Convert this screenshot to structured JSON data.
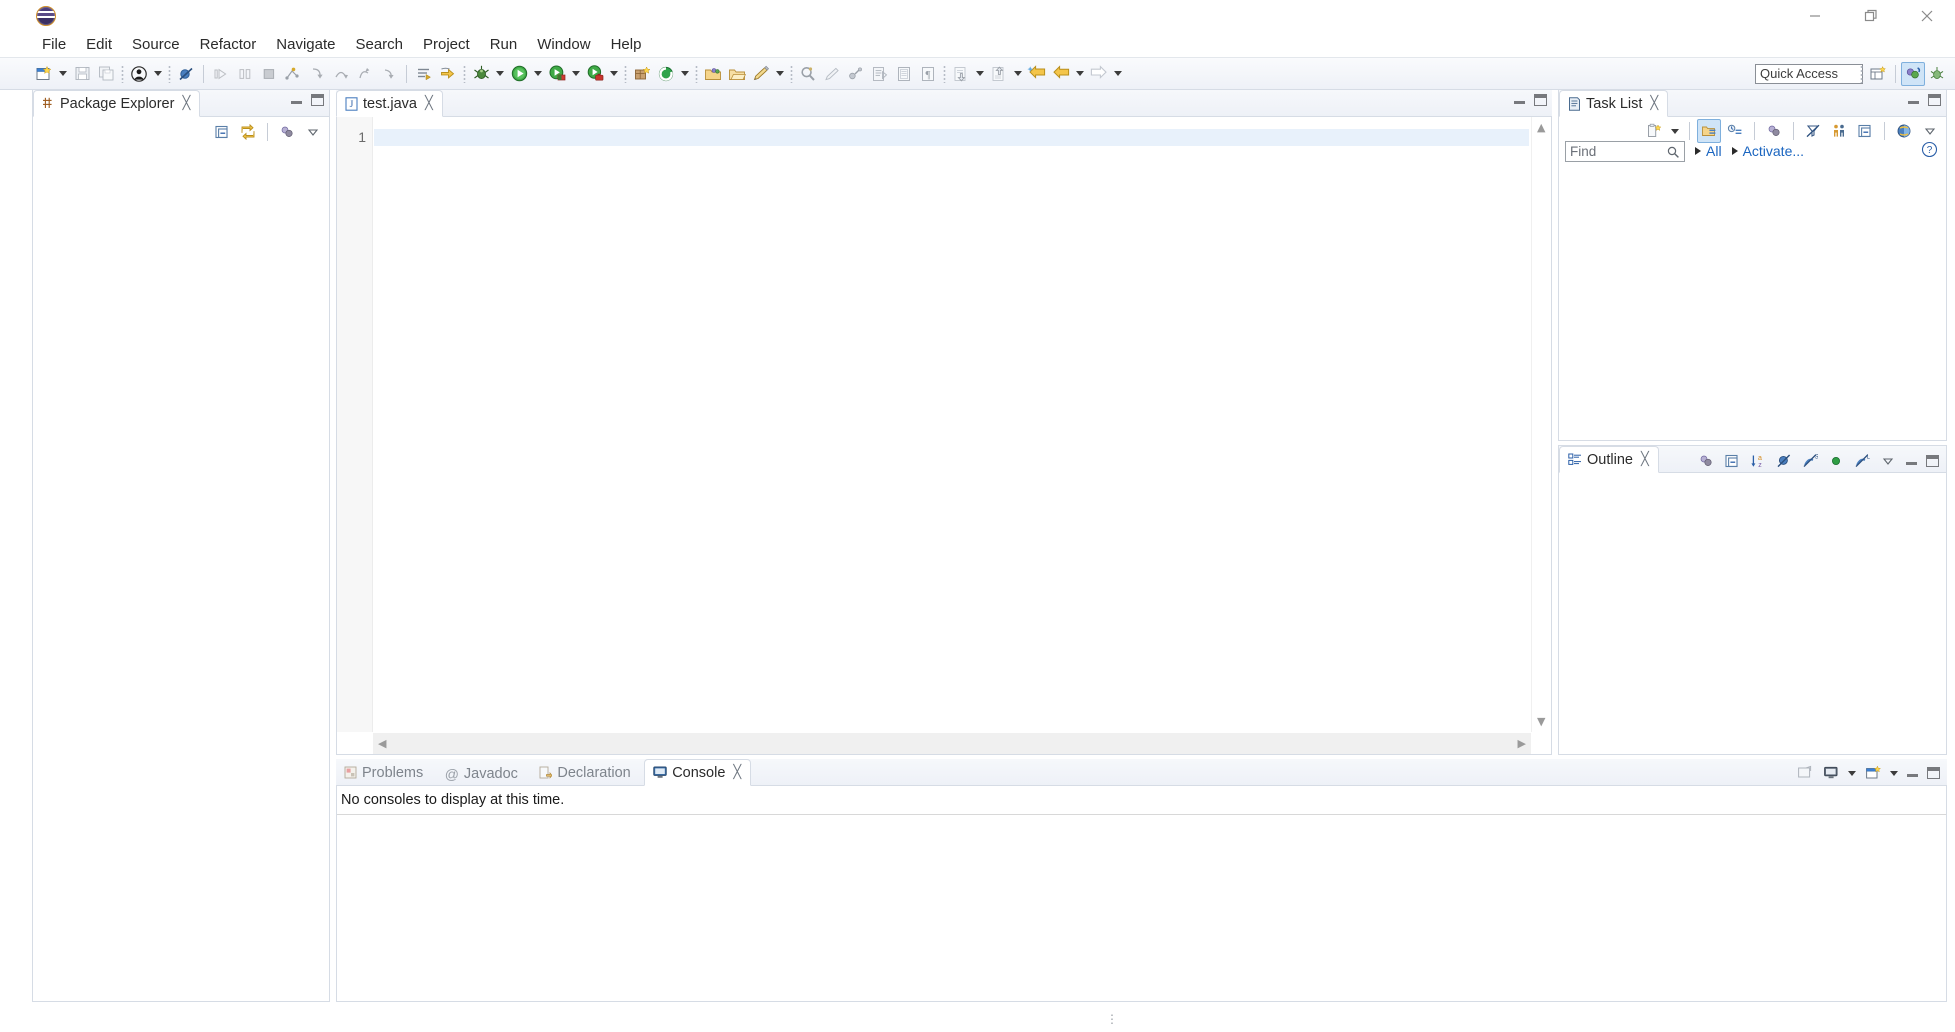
{
  "window": {
    "title": "",
    "logo_icon": "eclipse-logo-icon",
    "controls": [
      {
        "name": "minimize-button",
        "glyph": "—"
      },
      {
        "name": "restore-button",
        "glyph": "❐"
      },
      {
        "name": "close-button",
        "glyph": "✕"
      }
    ]
  },
  "menubar": {
    "items": [
      {
        "label": "File"
      },
      {
        "label": "Edit"
      },
      {
        "label": "Source"
      },
      {
        "label": "Refactor"
      },
      {
        "label": "Navigate"
      },
      {
        "label": "Search"
      },
      {
        "label": "Project"
      },
      {
        "label": "Run"
      },
      {
        "label": "Window"
      },
      {
        "label": "Help"
      }
    ]
  },
  "toolbar": {
    "groups": [
      {
        "items": [
          {
            "name": "new-wizard-button",
            "icon": "new-file-icon",
            "dropdown": true
          },
          {
            "name": "save-button",
            "icon": "save-icon"
          },
          {
            "name": "save-all-button",
            "icon": "save-all-icon"
          }
        ]
      },
      {
        "items": [
          {
            "name": "open-type-button",
            "icon": "person-icon",
            "dropdown": true
          }
        ]
      },
      {
        "items": [
          {
            "name": "skip-breakpoints-button",
            "icon": "skip-breakpoints-icon"
          }
        ]
      },
      {
        "items": [
          {
            "name": "resume-button",
            "icon": "resume-icon"
          },
          {
            "name": "suspend-button",
            "icon": "suspend-icon"
          },
          {
            "name": "terminate-button",
            "icon": "terminate-icon"
          },
          {
            "name": "disconnect-button",
            "icon": "disconnect-icon"
          },
          {
            "name": "step-into-button",
            "icon": "step-into-icon"
          },
          {
            "name": "step-over-button",
            "icon": "step-over-icon"
          },
          {
            "name": "step-return-button",
            "icon": "step-return-icon"
          },
          {
            "name": "drop-to-frame-button",
            "icon": "drop-to-frame-icon"
          }
        ]
      },
      {
        "items": [
          {
            "name": "toggle-mark-occurrences-button",
            "icon": "mark-occurrences-icon"
          },
          {
            "name": "next-annotation-button",
            "icon": "next-annotation-icon"
          }
        ]
      },
      {
        "items": [
          {
            "name": "debug-button",
            "icon": "debug-bug-icon",
            "dropdown": true
          },
          {
            "name": "run-button",
            "icon": "run-green-play-icon",
            "dropdown": true
          },
          {
            "name": "coverage-button",
            "icon": "coverage-icon",
            "dropdown": true
          },
          {
            "name": "external-tools-button",
            "icon": "external-tools-icon",
            "dropdown": true
          }
        ]
      },
      {
        "items": [
          {
            "name": "new-java-package-button",
            "icon": "new-package-icon"
          },
          {
            "name": "new-java-class-button",
            "icon": "new-class-icon",
            "dropdown": true
          }
        ]
      },
      {
        "items": [
          {
            "name": "open-task-button",
            "icon": "open-task-icon"
          },
          {
            "name": "open-folder-button",
            "icon": "open-folder-icon"
          },
          {
            "name": "new-task-button",
            "icon": "new-task-pencil-icon",
            "dropdown": true
          }
        ]
      },
      {
        "items": [
          {
            "name": "search-button",
            "icon": "search-icon"
          },
          {
            "name": "highlight-button",
            "icon": "highlight-icon"
          },
          {
            "name": "link-button",
            "icon": "link-icon"
          },
          {
            "name": "edit-doc-button",
            "icon": "edit-doc-icon"
          },
          {
            "name": "document-button",
            "icon": "document-icon"
          },
          {
            "name": "pilcrow-button",
            "icon": "pilcrow-icon"
          }
        ]
      },
      {
        "items": [
          {
            "name": "previous-edit-button",
            "icon": "down-annotation-icon",
            "dropdown": true
          },
          {
            "name": "next-edit-button",
            "icon": "up-annotation-icon",
            "dropdown": true
          },
          {
            "name": "last-edit-location-button",
            "icon": "last-edit-arrow-icon"
          },
          {
            "name": "back-button",
            "icon": "back-arrow-icon",
            "dropdown": true
          },
          {
            "name": "forward-button",
            "icon": "forward-arrow-icon",
            "dropdown": true
          }
        ]
      }
    ],
    "quick_access": {
      "name": "quick-access-field",
      "placeholder": "Quick Access",
      "value": "Quick Access"
    },
    "perspective_buttons": [
      {
        "name": "open-perspective-button",
        "icon": "open-perspective-icon"
      },
      {
        "name": "perspective-java-button",
        "icon": "java-perspective-icon",
        "active": true
      },
      {
        "name": "perspective-debug-button",
        "icon": "debug-perspective-icon",
        "active": false
      }
    ]
  },
  "package_explorer": {
    "tab": {
      "label": "Package Explorer",
      "icon": "package-explorer-icon",
      "close": "╳"
    },
    "controls": [
      {
        "name": "minimize-view-button",
        "icon": "minimize-icon"
      },
      {
        "name": "maximize-view-button",
        "icon": "maximize-icon"
      }
    ],
    "toolbar": [
      {
        "name": "collapse-all-button",
        "icon": "collapse-all-icon"
      },
      {
        "name": "link-with-editor-button",
        "icon": "link-with-editor-icon"
      },
      {
        "name": "view-menu-filters-button",
        "icon": "filters-icon"
      },
      {
        "name": "view-menu-button",
        "icon": "view-menu-chevron-icon"
      }
    ],
    "content": []
  },
  "editor": {
    "tab": {
      "label": "test.java",
      "icon": "java-file-icon",
      "close": "╳",
      "active": true
    },
    "controls": [
      {
        "name": "minimize-editor-button",
        "icon": "minimize-icon"
      },
      {
        "name": "maximize-editor-button",
        "icon": "maximize-icon"
      }
    ],
    "line_numbers": [
      "1"
    ],
    "lines": [
      ""
    ],
    "cursor_line": 1
  },
  "task_list": {
    "tab": {
      "label": "Task List",
      "icon": "task-list-icon",
      "close": "╳"
    },
    "controls": [
      {
        "name": "minimize-view-button",
        "icon": "minimize-icon"
      },
      {
        "name": "maximize-view-button",
        "icon": "maximize-icon"
      }
    ],
    "toolbar": [
      {
        "name": "new-task-button",
        "icon": "new-task-icon",
        "dropdown": true
      },
      {
        "name": "categorized-presentation-button",
        "icon": "categorized-icon",
        "active": true
      },
      {
        "name": "scheduled-presentation-button",
        "icon": "scheduled-icon",
        "active": false
      },
      {
        "name": "focus-on-workweek-button",
        "icon": "focus-icon"
      },
      {
        "name": "filter-completed-button",
        "icon": "filter-completed-icon"
      },
      {
        "name": "show-all-button",
        "icon": "show-all-people-icon"
      },
      {
        "name": "collapse-all-button",
        "icon": "collapse-all-icon"
      },
      {
        "name": "synchronize-changed-button",
        "icon": "synchronize-icon"
      },
      {
        "name": "view-menu-button",
        "icon": "view-menu-chevron-icon"
      }
    ],
    "find": {
      "name": "task-find-input",
      "placeholder": "Find",
      "value": "Find",
      "icon": "search-icon"
    },
    "links": [
      {
        "name": "all-filter-link",
        "label": "All"
      },
      {
        "name": "activate-link",
        "label": "Activate..."
      }
    ],
    "help_icon": "help-question-icon",
    "content": []
  },
  "outline": {
    "tab": {
      "label": "Outline",
      "icon": "outline-icon",
      "close": "╳"
    },
    "toolbar": [
      {
        "name": "focus-on-active-task-button",
        "icon": "focus-task-icon"
      },
      {
        "name": "collapse-all-button",
        "icon": "collapse-all-icon"
      },
      {
        "name": "sort-button",
        "icon": "sort-az-icon"
      },
      {
        "name": "hide-fields-button",
        "icon": "hide-fields-icon"
      },
      {
        "name": "hide-static-button",
        "icon": "hide-static-icon"
      },
      {
        "name": "hide-non-public-button",
        "icon": "hide-nonpublic-icon"
      },
      {
        "name": "hide-local-types-button",
        "icon": "hide-local-types-icon"
      },
      {
        "name": "view-menu-button",
        "icon": "view-menu-chevron-icon"
      },
      {
        "name": "minimize-view-button",
        "icon": "minimize-icon"
      },
      {
        "name": "maximize-view-button",
        "icon": "maximize-icon"
      }
    ],
    "content": []
  },
  "bottom_panel": {
    "tabs": [
      {
        "name": "tab-problems",
        "label": "Problems",
        "icon": "problems-icon",
        "active": false
      },
      {
        "name": "tab-javadoc",
        "label": "Javadoc",
        "icon": "javadoc-at-icon",
        "active": false
      },
      {
        "name": "tab-declaration",
        "label": "Declaration",
        "icon": "declaration-icon",
        "active": false
      },
      {
        "name": "tab-console",
        "label": "Console",
        "icon": "console-icon",
        "active": true,
        "close": "╳"
      }
    ],
    "toolbar": [
      {
        "name": "open-console-button",
        "icon": "open-console-icon"
      },
      {
        "name": "display-selected-console-button",
        "icon": "display-console-icon",
        "dropdown": true
      },
      {
        "name": "new-console-view-button",
        "icon": "new-console-icon",
        "dropdown": true
      },
      {
        "name": "minimize-view-button",
        "icon": "minimize-icon"
      },
      {
        "name": "maximize-view-button",
        "icon": "maximize-icon"
      }
    ],
    "console_message": "No consoles to display at this time."
  },
  "statusbar": {
    "grip_icon": "resize-grip-icon"
  },
  "colors": {
    "accent": "#1a65c0",
    "chrome": "#eef1f7",
    "border": "#d6dce5",
    "current_line": "#e8f1fb",
    "tab_inactive_text": "#7e848c"
  }
}
